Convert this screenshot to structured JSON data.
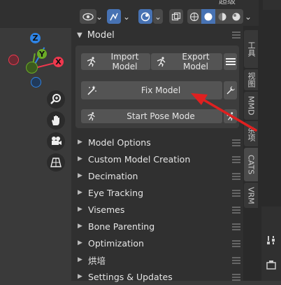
{
  "header": {
    "cut_text": "超级",
    "icons": [
      "eye-visibility-icon",
      "chevron-down-icon",
      "selectability-icon",
      "chevron-down-icon",
      "overlay-icon",
      "chevron-down-icon",
      "xray-icon",
      "wireframe-shading-icon",
      "solid-shading-icon",
      "material-shading-icon",
      "rendered-shading-icon",
      "chevron-down-icon"
    ]
  },
  "gizmo": {
    "z_label": "Z",
    "y_label": "Y",
    "x_label": "X",
    "colors": {
      "x": "#f0384e",
      "y": "#6bac26",
      "z": "#2e84e6"
    }
  },
  "nav_tools": [
    "zoom-icon",
    "hand-pan-icon",
    "camera-icon",
    "grid-perspective-icon"
  ],
  "panel": {
    "title": "Model",
    "import_model": "Import Model",
    "export_model": "Export Model",
    "fix_model": "Fix Model",
    "start_pose_mode": "Start Pose Mode"
  },
  "sections": [
    "Model Options",
    "Custom Model Creation",
    "Decimation",
    "Eye Tracking",
    "Visemes",
    "Bone Parenting",
    "Optimization",
    "烘培",
    "Settings & Updates"
  ],
  "tabs": [
    "工具",
    "视图",
    "MMD",
    "杂项",
    "CATS",
    "VRM"
  ],
  "annotation": {
    "arrow_color": "#e02020"
  }
}
